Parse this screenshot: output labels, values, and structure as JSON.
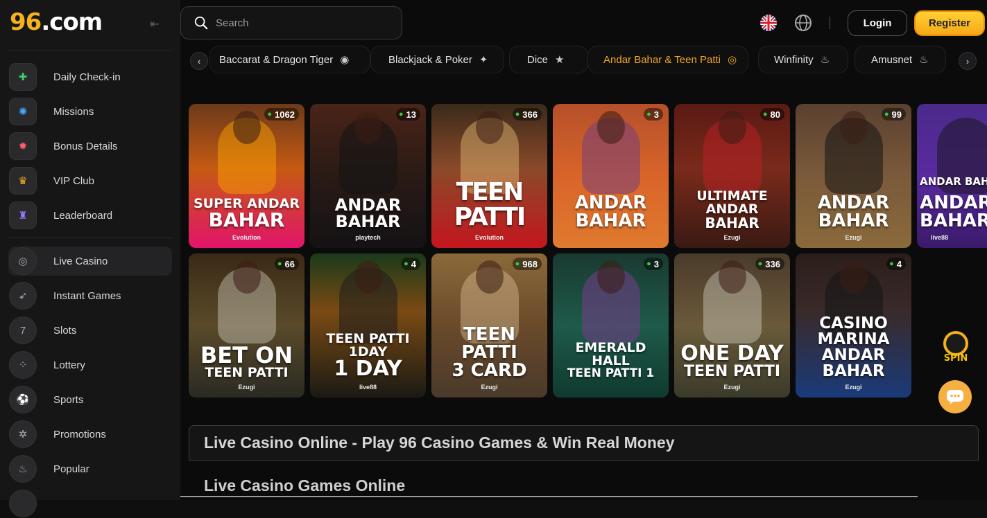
{
  "brand": {
    "logo_nine": "96",
    "logo_rest": ".com",
    "accent": "#f5b31b"
  },
  "sidebar": {
    "items": [
      {
        "label": "Daily Check-in",
        "icon": "gift-icon"
      },
      {
        "label": "Missions",
        "icon": "target-icon"
      },
      {
        "label": "Bonus Details",
        "icon": "bonus-icon"
      },
      {
        "label": "VIP Club",
        "icon": "crown-icon"
      },
      {
        "label": "Leaderboard",
        "icon": "trophy-icon"
      },
      {
        "label": "Live Casino",
        "icon": "chip-icon",
        "active": true
      },
      {
        "label": "Instant Games",
        "icon": "rocket-icon"
      },
      {
        "label": "Slots",
        "icon": "seven-icon"
      },
      {
        "label": "Lottery",
        "icon": "lottery-icon"
      },
      {
        "label": "Sports",
        "icon": "ball-icon"
      },
      {
        "label": "Promotions",
        "icon": "promo-icon"
      },
      {
        "label": "Popular",
        "icon": "flame-icon"
      }
    ]
  },
  "header": {
    "search_placeholder": "Search",
    "login_label": "Login",
    "register_label": "Register"
  },
  "categories": [
    {
      "label": "Baccarat & Dragon Tiger",
      "icon": "◉"
    },
    {
      "label": "Blackjack & Poker",
      "icon": "✦"
    },
    {
      "label": "Dice",
      "icon": "★"
    },
    {
      "label": "Andar Bahar & Teen Patti",
      "icon": "◎",
      "active": true
    },
    {
      "label": "Winfinity",
      "icon": "♨"
    },
    {
      "label": "Amusnet",
      "icon": "♨"
    }
  ],
  "games": [
    {
      "l1": "SUPER ANDAR",
      "l2": "BAHAR",
      "players": "1062",
      "provider": "Evolution"
    },
    {
      "l1": "ANDAR",
      "l2": "BAHAR",
      "players": "13",
      "provider": "playtech"
    },
    {
      "l1": "",
      "l2": "TEEN PATTI",
      "players": "366",
      "provider": "Evolution"
    },
    {
      "l1": "ANDAR",
      "l2": "BAHAR",
      "players": "3",
      "provider": ""
    },
    {
      "l1": "ULTIMATE ANDAR",
      "l2": "BAHAR",
      "players": "80",
      "provider": "Ezugi"
    },
    {
      "l1": "ANDAR",
      "l2": "BAHAR",
      "players": "99",
      "provider": "Ezugi"
    },
    {
      "l1": "ANDAR BAHAR",
      "l2": "ANDAR BAHAR",
      "players": "",
      "provider": "live88"
    },
    {
      "l1": "BET ON",
      "l2": "TEEN PATTI",
      "players": "66",
      "provider": "Ezugi"
    },
    {
      "l1": "TEEN PATTI 1DAY",
      "l2": "1 DAY",
      "players": "4",
      "provider": "live88"
    },
    {
      "l1": "TEEN PATTI",
      "l2": "3 CARD",
      "players": "968",
      "provider": "Ezugi"
    },
    {
      "l1": "EMERALD HALL",
      "l2": "TEEN PATTI 1",
      "players": "3",
      "provider": ""
    },
    {
      "l1": "ONE DAY",
      "l2": "TEEN PATTI",
      "players": "336",
      "provider": "Ezugi"
    },
    {
      "l1": "CASINO MARINA",
      "l2": "ANDAR BAHAR",
      "players": "4",
      "provider": "Ezugi"
    }
  ],
  "floating": {
    "spin_label": "SPIN"
  },
  "content": {
    "info_title": "Live Casino Online - Play 96 Casino Games & Win Real Money",
    "section_title": "Live Casino Games Online"
  }
}
